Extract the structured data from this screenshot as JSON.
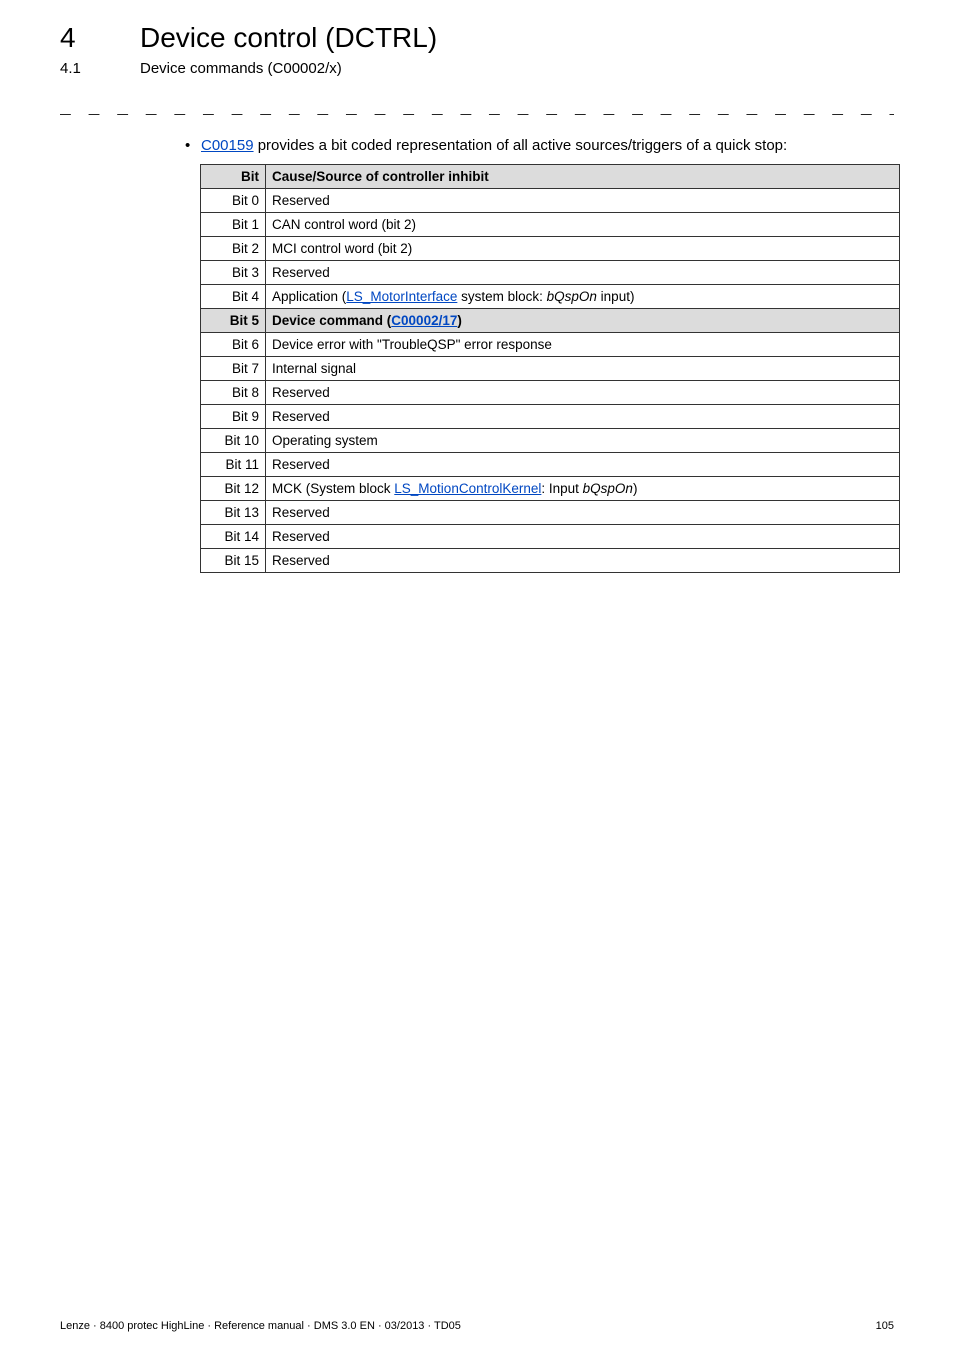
{
  "header": {
    "chapterNum": "4",
    "chapterTitle": "Device control (DCTRL)",
    "sectionNum": "4.1",
    "sectionTitle": "Device commands (C00002/x)"
  },
  "bullet": {
    "link": "C00159",
    "tail": " provides a bit coded representation of all active sources/triggers of a quick stop:"
  },
  "table": {
    "headBit": "Bit",
    "headCause": "Cause/Source of controller inhibit",
    "rows": [
      {
        "bit": "Bit 0",
        "parts": [
          {
            "t": "text",
            "v": "Reserved"
          }
        ]
      },
      {
        "bit": "Bit 1",
        "parts": [
          {
            "t": "text",
            "v": "CAN control word (bit 2)"
          }
        ]
      },
      {
        "bit": "Bit 2",
        "parts": [
          {
            "t": "text",
            "v": "MCI control word (bit 2)"
          }
        ]
      },
      {
        "bit": "Bit 3",
        "parts": [
          {
            "t": "text",
            "v": "Reserved"
          }
        ]
      },
      {
        "bit": "Bit 4",
        "parts": [
          {
            "t": "text",
            "v": "Application ("
          },
          {
            "t": "link",
            "v": "LS_MotorInterface"
          },
          {
            "t": "text",
            "v": " system block: "
          },
          {
            "t": "ital",
            "v": "bQspOn"
          },
          {
            "t": "text",
            "v": " input)"
          }
        ]
      },
      {
        "bit": "Bit 5",
        "hl": true,
        "parts": [
          {
            "t": "text",
            "v": "Device command "
          },
          {
            "t": "text",
            "v": "("
          },
          {
            "t": "link",
            "v": "C00002/17"
          },
          {
            "t": "text",
            "v": ")"
          }
        ]
      },
      {
        "bit": "Bit 6",
        "parts": [
          {
            "t": "text",
            "v": "Device error with \"TroubleQSP\" error response"
          }
        ]
      },
      {
        "bit": "Bit 7",
        "parts": [
          {
            "t": "text",
            "v": "Internal signal"
          }
        ]
      },
      {
        "bit": "Bit 8",
        "parts": [
          {
            "t": "text",
            "v": "Reserved"
          }
        ]
      },
      {
        "bit": "Bit 9",
        "parts": [
          {
            "t": "text",
            "v": "Reserved"
          }
        ]
      },
      {
        "bit": "Bit 10",
        "parts": [
          {
            "t": "text",
            "v": "Operating system"
          }
        ]
      },
      {
        "bit": "Bit 11",
        "parts": [
          {
            "t": "text",
            "v": "Reserved"
          }
        ]
      },
      {
        "bit": "Bit 12",
        "parts": [
          {
            "t": "text",
            "v": "MCK (System block "
          },
          {
            "t": "link",
            "v": "LS_MotionControlKernel"
          },
          {
            "t": "text",
            "v": ": Input "
          },
          {
            "t": "ital",
            "v": "bQspOn"
          },
          {
            "t": "text",
            "v": ")"
          }
        ]
      },
      {
        "bit": "Bit 13",
        "parts": [
          {
            "t": "text",
            "v": "Reserved"
          }
        ]
      },
      {
        "bit": "Bit 14",
        "parts": [
          {
            "t": "text",
            "v": "Reserved"
          }
        ]
      },
      {
        "bit": "Bit 15",
        "parts": [
          {
            "t": "text",
            "v": "Reserved"
          }
        ]
      }
    ]
  },
  "footer": {
    "left": "Lenze · 8400 protec HighLine · Reference manual · DMS 3.0 EN · 03/2013 · TD05",
    "right": "105"
  }
}
